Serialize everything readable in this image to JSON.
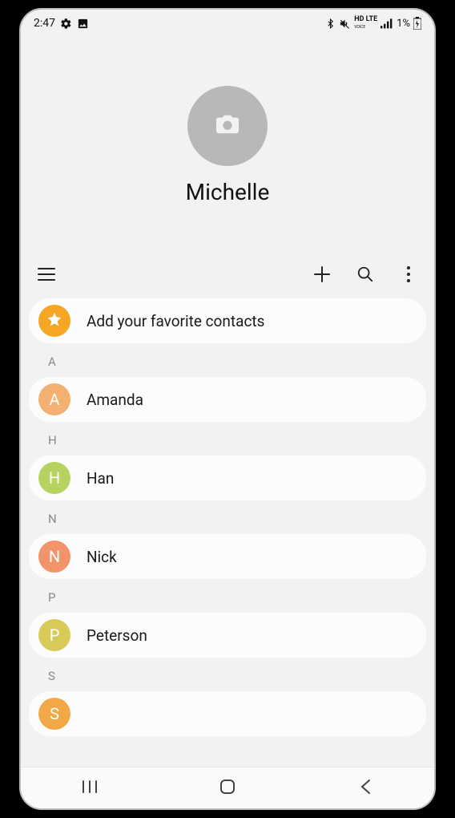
{
  "status": {
    "time": "2:47",
    "network_label": "HD LTE",
    "network_sub": "VOICE",
    "battery_text": "1%"
  },
  "profile": {
    "name": "Michelle"
  },
  "favorites_row": {
    "label": "Add your favorite contacts"
  },
  "sections": [
    {
      "letter": "A",
      "contacts": [
        {
          "name": "Amanda",
          "initial": "A",
          "color": "#f3b071"
        }
      ]
    },
    {
      "letter": "H",
      "contacts": [
        {
          "name": "Han",
          "initial": "H",
          "color": "#b7d25e"
        }
      ]
    },
    {
      "letter": "N",
      "contacts": [
        {
          "name": "Nick",
          "initial": "N",
          "color": "#f3936a"
        }
      ]
    },
    {
      "letter": "P",
      "contacts": [
        {
          "name": "Peterson",
          "initial": "P",
          "color": "#d8ca58"
        }
      ]
    },
    {
      "letter": "S",
      "contacts": [
        {
          "name": "",
          "initial": "S",
          "color": "#f3a848"
        }
      ]
    }
  ]
}
